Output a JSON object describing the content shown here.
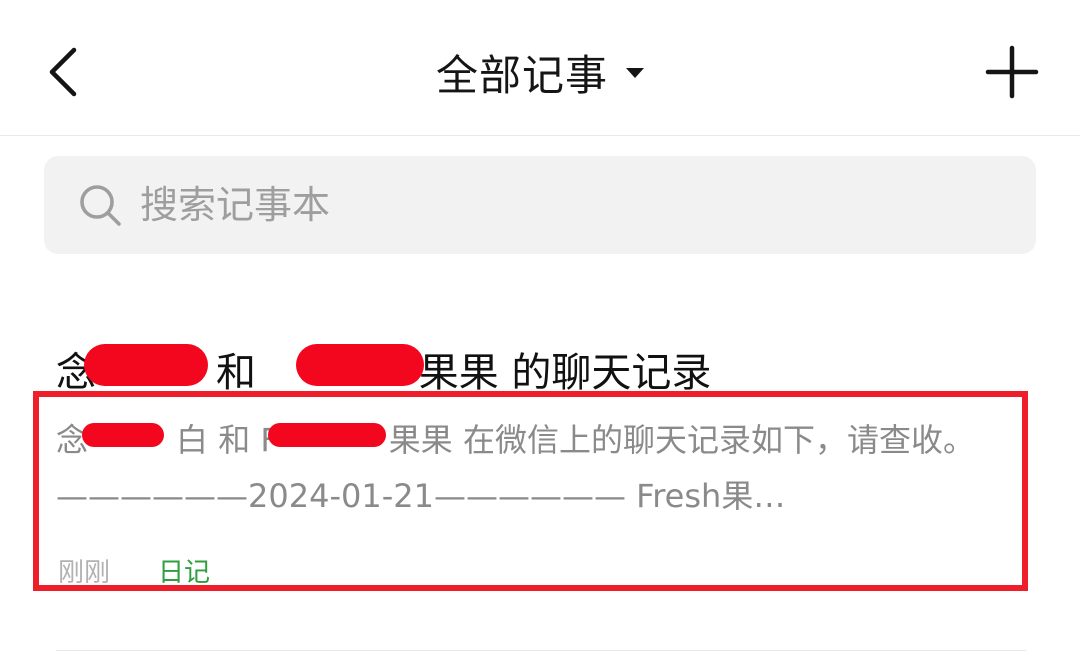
{
  "header": {
    "title": "全部记事"
  },
  "search": {
    "placeholder": "搜索记事本",
    "value": ""
  },
  "notes": [
    {
      "title": "念",
      "title_mid": "和 ",
      "title_end": "果果 的聊天记录",
      "preview_start": "念",
      "preview_mid": "白 和 F",
      "preview_end": "果果 在微信上的聊天记录如下，请查收。 ——————2024-01-21——————  Fresh果…",
      "time": "刚刚",
      "tag": "日记"
    }
  ],
  "colors": {
    "accent_tag": "#2e9e3e",
    "highlight": "#ee1f2b",
    "redaction": "#f2071f"
  }
}
